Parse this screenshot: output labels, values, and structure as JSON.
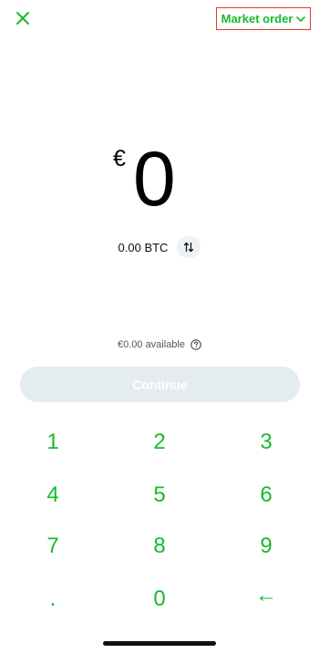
{
  "header": {
    "close_icon": "close-icon",
    "order_type_label": "Market order",
    "order_type_icon": "chevron-down-icon"
  },
  "amount": {
    "currency_symbol": "€",
    "value": "0"
  },
  "crypto": {
    "equivalent": "0.00 BTC",
    "swap_icon": "swap-vertical-icon"
  },
  "available": {
    "text": "€0.00 available",
    "icon": "help-icon"
  },
  "continue": {
    "label": "Continue"
  },
  "keypad": {
    "keys": [
      "1",
      "2",
      "3",
      "4",
      "5",
      "6",
      "7",
      "8",
      "9",
      ".",
      "0",
      "←"
    ]
  },
  "colors": {
    "accent": "#16b92f",
    "button_disabled_bg": "#e4ecef",
    "order_outline": "#e23b2e"
  }
}
